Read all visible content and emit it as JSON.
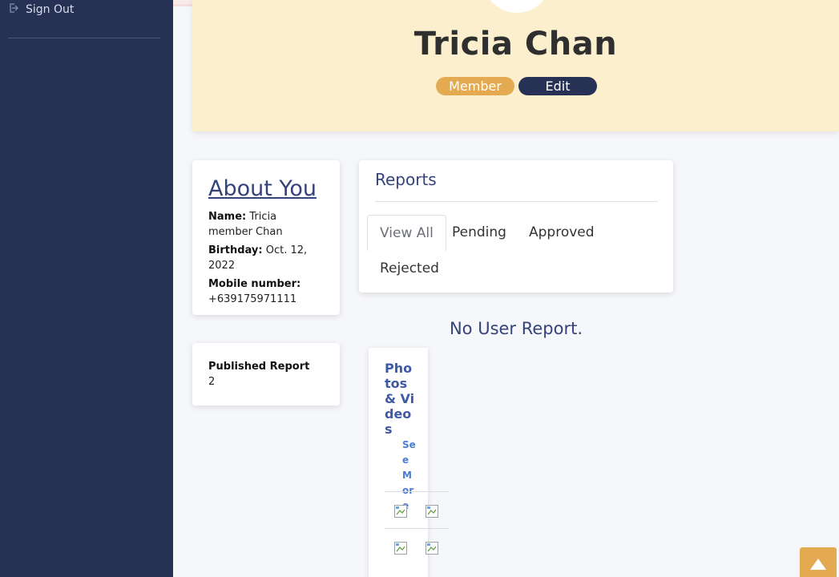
{
  "sidebar": {
    "signout_label": "Sign Out"
  },
  "profile": {
    "name": "Tricia Chan",
    "role_badge": "Member",
    "edit_label": "Edit"
  },
  "about": {
    "title": "About You",
    "name_label": "Name:",
    "name_value": "Tricia member Chan",
    "birthday_label": "Birthday:",
    "birthday_value": "Oct. 12, 2022",
    "mobile_label": "Mobile number:",
    "mobile_value": "+639175971111"
  },
  "published": {
    "label": "Published Report",
    "value": "2"
  },
  "reports": {
    "title": "Reports",
    "tabs": [
      {
        "label": "View All"
      },
      {
        "label": "Pending"
      },
      {
        "label": "Approved"
      },
      {
        "label": "Rejected"
      }
    ],
    "empty_message": "No User Report."
  },
  "media": {
    "title": "Photos & Videos",
    "see_more": "See More"
  },
  "colors": {
    "sidebar_bg": "#263155",
    "hero_bg": "#fbefcd",
    "accent": "#e3aa52",
    "heading": "#34437a"
  },
  "icons": {
    "signout": "sign-out-icon",
    "scroll_top": "triangle-up-icon",
    "broken_image": "broken-image-icon"
  }
}
